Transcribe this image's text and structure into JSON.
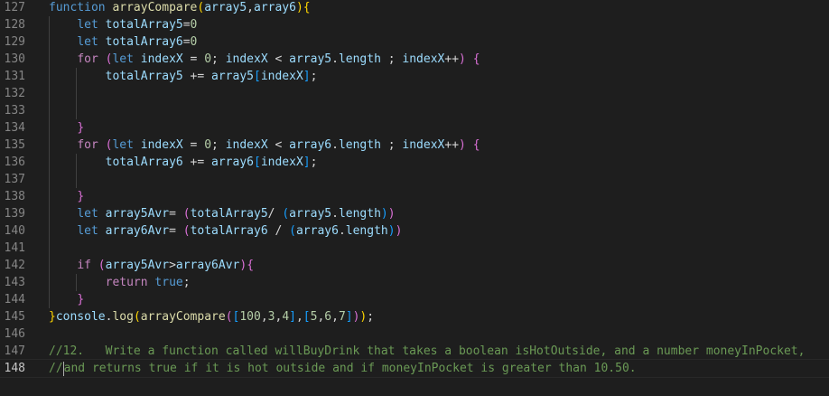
{
  "editor": {
    "language": "javascript",
    "current_line": "148",
    "lines": [
      {
        "num": "127",
        "tokens": [
          [
            "function",
            "kw"
          ],
          [
            " ",
            ""
          ],
          [
            "arrayCompare",
            "fn"
          ],
          [
            "(",
            "p1"
          ],
          [
            "array5",
            "var"
          ],
          [
            ",",
            "op"
          ],
          [
            "array6",
            "var"
          ],
          [
            ")",
            "p1"
          ],
          [
            "{",
            "p1"
          ]
        ]
      },
      {
        "num": "128",
        "tokens": [
          [
            "    ",
            ""
          ],
          [
            "let",
            "kw"
          ],
          [
            " ",
            ""
          ],
          [
            "totalArray5",
            "var"
          ],
          [
            "=",
            "op"
          ],
          [
            "0",
            "num"
          ]
        ]
      },
      {
        "num": "129",
        "tokens": [
          [
            "    ",
            ""
          ],
          [
            "let",
            "kw"
          ],
          [
            " ",
            ""
          ],
          [
            "totalArray6",
            "var"
          ],
          [
            "=",
            "op"
          ],
          [
            "0",
            "num"
          ]
        ]
      },
      {
        "num": "130",
        "tokens": [
          [
            "    ",
            ""
          ],
          [
            "for",
            "ctl"
          ],
          [
            " ",
            ""
          ],
          [
            "(",
            "p2"
          ],
          [
            "let",
            "kw"
          ],
          [
            " ",
            ""
          ],
          [
            "indexX",
            "var"
          ],
          [
            " = ",
            "op"
          ],
          [
            "0",
            "num"
          ],
          [
            "; ",
            "op"
          ],
          [
            "indexX",
            "var"
          ],
          [
            " < ",
            "op"
          ],
          [
            "array5",
            "var"
          ],
          [
            ".",
            "op"
          ],
          [
            "length",
            "var"
          ],
          [
            " ; ",
            "op"
          ],
          [
            "indexX",
            "var"
          ],
          [
            "++",
            "op"
          ],
          [
            ")",
            "p2"
          ],
          [
            " ",
            ""
          ],
          [
            "{",
            "p2"
          ]
        ]
      },
      {
        "num": "131",
        "tokens": [
          [
            "        ",
            ""
          ],
          [
            "totalArray5",
            "var"
          ],
          [
            " += ",
            "op"
          ],
          [
            "array5",
            "var"
          ],
          [
            "[",
            "p3"
          ],
          [
            "indexX",
            "var"
          ],
          [
            "]",
            "p3"
          ],
          [
            ";",
            "op"
          ]
        ]
      },
      {
        "num": "132",
        "tokens": []
      },
      {
        "num": "133",
        "tokens": []
      },
      {
        "num": "134",
        "tokens": [
          [
            "    ",
            ""
          ],
          [
            "}",
            "p2"
          ]
        ]
      },
      {
        "num": "135",
        "tokens": [
          [
            "    ",
            ""
          ],
          [
            "for",
            "ctl"
          ],
          [
            " ",
            ""
          ],
          [
            "(",
            "p2"
          ],
          [
            "let",
            "kw"
          ],
          [
            " ",
            ""
          ],
          [
            "indexX",
            "var"
          ],
          [
            " = ",
            "op"
          ],
          [
            "0",
            "num"
          ],
          [
            "; ",
            "op"
          ],
          [
            "indexX",
            "var"
          ],
          [
            " < ",
            "op"
          ],
          [
            "array6",
            "var"
          ],
          [
            ".",
            "op"
          ],
          [
            "length",
            "var"
          ],
          [
            " ; ",
            "op"
          ],
          [
            "indexX",
            "var"
          ],
          [
            "++",
            "op"
          ],
          [
            ")",
            "p2"
          ],
          [
            " ",
            ""
          ],
          [
            "{",
            "p2"
          ]
        ]
      },
      {
        "num": "136",
        "tokens": [
          [
            "        ",
            ""
          ],
          [
            "totalArray6",
            "var"
          ],
          [
            " += ",
            "op"
          ],
          [
            "array6",
            "var"
          ],
          [
            "[",
            "p3"
          ],
          [
            "indexX",
            "var"
          ],
          [
            "]",
            "p3"
          ],
          [
            ";",
            "op"
          ]
        ]
      },
      {
        "num": "137",
        "tokens": []
      },
      {
        "num": "138",
        "tokens": [
          [
            "    ",
            ""
          ],
          [
            "}",
            "p2"
          ]
        ]
      },
      {
        "num": "139",
        "tokens": [
          [
            "    ",
            ""
          ],
          [
            "let",
            "kw"
          ],
          [
            " ",
            ""
          ],
          [
            "array5Avr",
            "var"
          ],
          [
            "= ",
            "op"
          ],
          [
            "(",
            "p2"
          ],
          [
            "totalArray5",
            "var"
          ],
          [
            "/ ",
            "op"
          ],
          [
            "(",
            "p3"
          ],
          [
            "array5",
            "var"
          ],
          [
            ".",
            "op"
          ],
          [
            "length",
            "var"
          ],
          [
            ")",
            "p3"
          ],
          [
            ")",
            "p2"
          ]
        ]
      },
      {
        "num": "140",
        "tokens": [
          [
            "    ",
            ""
          ],
          [
            "let",
            "kw"
          ],
          [
            " ",
            ""
          ],
          [
            "array6Avr",
            "var"
          ],
          [
            "= ",
            "op"
          ],
          [
            "(",
            "p2"
          ],
          [
            "totalArray6",
            "var"
          ],
          [
            " / ",
            "op"
          ],
          [
            "(",
            "p3"
          ],
          [
            "array6",
            "var"
          ],
          [
            ".",
            "op"
          ],
          [
            "length",
            "var"
          ],
          [
            ")",
            "p3"
          ],
          [
            ")",
            "p2"
          ]
        ]
      },
      {
        "num": "141",
        "tokens": []
      },
      {
        "num": "142",
        "tokens": [
          [
            "    ",
            ""
          ],
          [
            "if",
            "ctl"
          ],
          [
            " ",
            ""
          ],
          [
            "(",
            "p2"
          ],
          [
            "array5Avr",
            "var"
          ],
          [
            ">",
            "op"
          ],
          [
            "array6Avr",
            "var"
          ],
          [
            ")",
            "p2"
          ],
          [
            "{",
            "p2"
          ]
        ]
      },
      {
        "num": "143",
        "tokens": [
          [
            "        ",
            ""
          ],
          [
            "return",
            "ctl"
          ],
          [
            " ",
            ""
          ],
          [
            "true",
            "kw"
          ],
          [
            ";",
            "op"
          ]
        ]
      },
      {
        "num": "144",
        "tokens": [
          [
            "    ",
            ""
          ],
          [
            "}",
            "p2"
          ]
        ]
      },
      {
        "num": "145",
        "tokens": [
          [
            "}",
            "p1"
          ],
          [
            "console",
            "var"
          ],
          [
            ".",
            "op"
          ],
          [
            "log",
            "fn"
          ],
          [
            "(",
            "p1"
          ],
          [
            "arrayCompare",
            "fn"
          ],
          [
            "(",
            "p2"
          ],
          [
            "[",
            "p3"
          ],
          [
            "100",
            "num"
          ],
          [
            ",",
            "op"
          ],
          [
            "3",
            "num"
          ],
          [
            ",",
            "op"
          ],
          [
            "4",
            "num"
          ],
          [
            "]",
            "p3"
          ],
          [
            ",",
            "op"
          ],
          [
            "[",
            "p3"
          ],
          [
            "5",
            "num"
          ],
          [
            ",",
            "op"
          ],
          [
            "6",
            "num"
          ],
          [
            ",",
            "op"
          ],
          [
            "7",
            "num"
          ],
          [
            "]",
            "p3"
          ],
          [
            ")",
            "p2"
          ],
          [
            ")",
            "p1"
          ],
          [
            ";",
            "op"
          ]
        ]
      },
      {
        "num": "146",
        "tokens": []
      },
      {
        "num": "147",
        "tokens": [
          [
            "//12.   Write a function called willBuyDrink that takes a boolean isHotOutside, and a number moneyInPocket,",
            "cmt"
          ]
        ]
      },
      {
        "num": "148",
        "tokens": [
          [
            "//",
            "cmt"
          ],
          [
            "|CURSOR|",
            "cursor"
          ],
          [
            "and returns true if it is hot outside and if moneyInPocket is greater than 10.50.",
            "cmt"
          ]
        ]
      }
    ]
  }
}
